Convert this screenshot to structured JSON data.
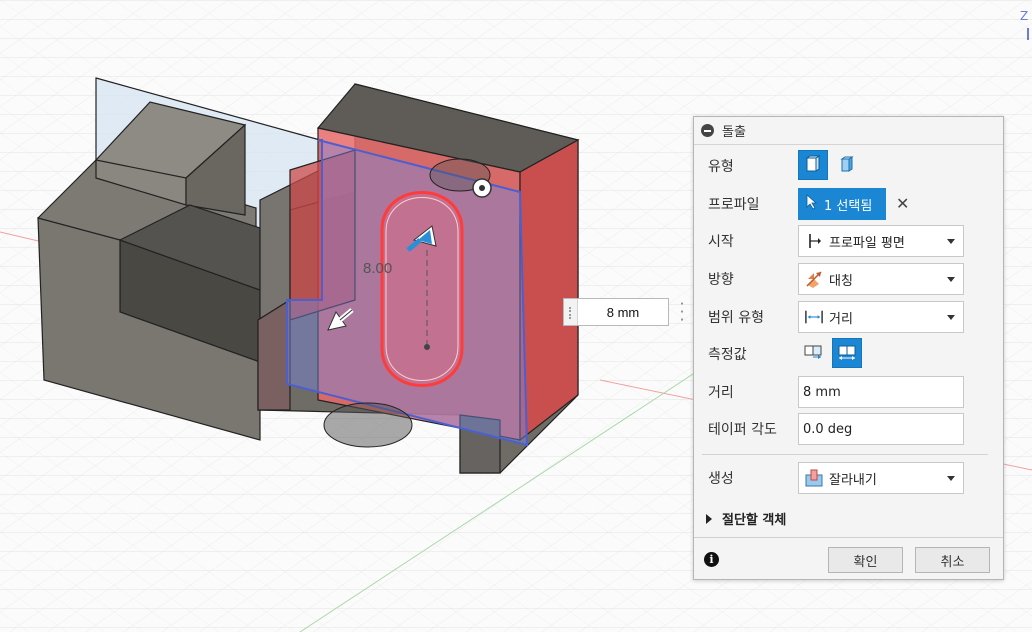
{
  "viewport": {
    "dimension_label": "8.00",
    "floating_value": "8 mm"
  },
  "panel": {
    "title": "돌출",
    "rows": {
      "type_label": "유형",
      "profile_label": "프로파일",
      "profile_value": "1 선택됨",
      "start_label": "시작",
      "start_value": "프로파일 평면",
      "direction_label": "방향",
      "direction_value": "대칭",
      "extent_label": "범위 유형",
      "extent_value": "거리",
      "measure_label": "측정값",
      "distance_label": "거리",
      "distance_value": "8 mm",
      "taper_label": "테이퍼 각도",
      "taper_value": "0.0 deg",
      "operation_label": "생성",
      "operation_value": "잘라내기"
    },
    "section_label": "절단할 객체",
    "ok_label": "확인",
    "cancel_label": "취소"
  },
  "icons": {
    "collapse": "minus-circle-icon",
    "type_solid": "solid-extrude-icon",
    "type_thin": "thin-extrude-icon",
    "profile_cursor": "select-cursor-icon",
    "clear": "close-icon",
    "start": "profile-plane-icon",
    "direction": "symmetric-icon",
    "extent": "distance-icon",
    "measure_half": "half-length-icon",
    "measure_whole": "whole-length-icon",
    "operation": "cut-icon",
    "info": "info-icon"
  },
  "colors": {
    "accent": "#1b87d4",
    "selection_red": "#ee3333",
    "plane_blue": "#5566cc"
  }
}
